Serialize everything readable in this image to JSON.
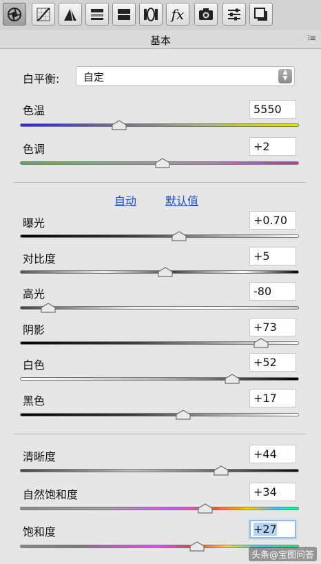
{
  "toolbar": {
    "tools": [
      {
        "icon": "aperture-icon",
        "active": true
      },
      {
        "icon": "tone-curve-icon"
      },
      {
        "icon": "sharpen-icon"
      },
      {
        "icon": "hsl-grayscale-icon"
      },
      {
        "icon": "split-toning-icon"
      },
      {
        "icon": "lens-correction-icon"
      },
      {
        "icon": "fx-icon",
        "text": "fx"
      },
      {
        "icon": "camera-calibration-icon"
      },
      {
        "icon": "presets-sliders-icon"
      },
      {
        "icon": "snapshots-icon"
      }
    ]
  },
  "panel": {
    "title": "基本",
    "menu_icon": "panel-menu-icon"
  },
  "white_balance": {
    "label": "白平衡:",
    "value": "自定"
  },
  "colors": {
    "temp_track": "linear-gradient(90deg,#2b2bd2,#6b6b9a,#b0b07a,#e8e800)",
    "tint_track": "linear-gradient(90deg,#31c631,#8aa58a,#ad84ad,#d026d0)",
    "dark_track": "linear-gradient(90deg,#000,#3a3a3a 40%,#bfbfbf 80%,#fff)",
    "light_track": "linear-gradient(90deg,#fff,#b6b6b6 50%,#000)",
    "vib_track": "linear-gradient(90deg,#8a8a8a,#9a9a9a 30%,#d050ff 55%,#ff5040 70%,#ffd000 82%,#40c0ff 92%,#00ff80)",
    "sat_track": "linear-gradient(90deg,#888,#7a7a7a 20%,#ff40ff 50%,#ff3030 62%,#ffe000 74%,#30d0ff 86%,#00ff60)",
    "contrast_track": "linear-gradient(90deg,#555,#eee 30%,#444 55%,#fff 80%,#000)",
    "clarity_track": "linear-gradient(90deg,#444,#bbb 40%,#888 60%,#111)",
    "highlight_track": "linear-gradient(90deg,#444,#eee 40%,#fff 70%,#ccc)"
  },
  "links": {
    "auto": "自动",
    "default": "默认值"
  },
  "sliders": [
    {
      "key": "temp",
      "label": "色温",
      "value": "5550",
      "pos": 0.355,
      "track": "temp_track"
    },
    {
      "key": "tint",
      "label": "色调",
      "value": "+2",
      "pos": 0.51,
      "track": "tint_track"
    },
    {
      "key": "exposure",
      "label": "曝光",
      "value": "+0.70",
      "pos": 0.57,
      "track": "dark_track"
    },
    {
      "key": "contrast",
      "label": "对比度",
      "value": "+5",
      "pos": 0.52,
      "track": "contrast_track"
    },
    {
      "key": "highlights",
      "label": "高光",
      "value": "-80",
      "pos": 0.1,
      "track": "highlight_track"
    },
    {
      "key": "shadows",
      "label": "阴影",
      "value": "+73",
      "pos": 0.865,
      "track": "dark_track"
    },
    {
      "key": "whites",
      "label": "白色",
      "value": "+52",
      "pos": 0.76,
      "track": "light_track"
    },
    {
      "key": "blacks",
      "label": "黑色",
      "value": "+17",
      "pos": 0.585,
      "track": "dark_track"
    },
    {
      "key": "clarity",
      "label": "清晰度",
      "value": "+44",
      "pos": 0.72,
      "track": "clarity_track"
    },
    {
      "key": "vibrance",
      "label": "自然饱和度",
      "value": "+34",
      "pos": 0.665,
      "track": "vib_track"
    },
    {
      "key": "saturation",
      "label": "饱和度",
      "value": "+27",
      "pos": 0.635,
      "track": "sat_track"
    }
  ],
  "watermark": "头条@宝图问答"
}
